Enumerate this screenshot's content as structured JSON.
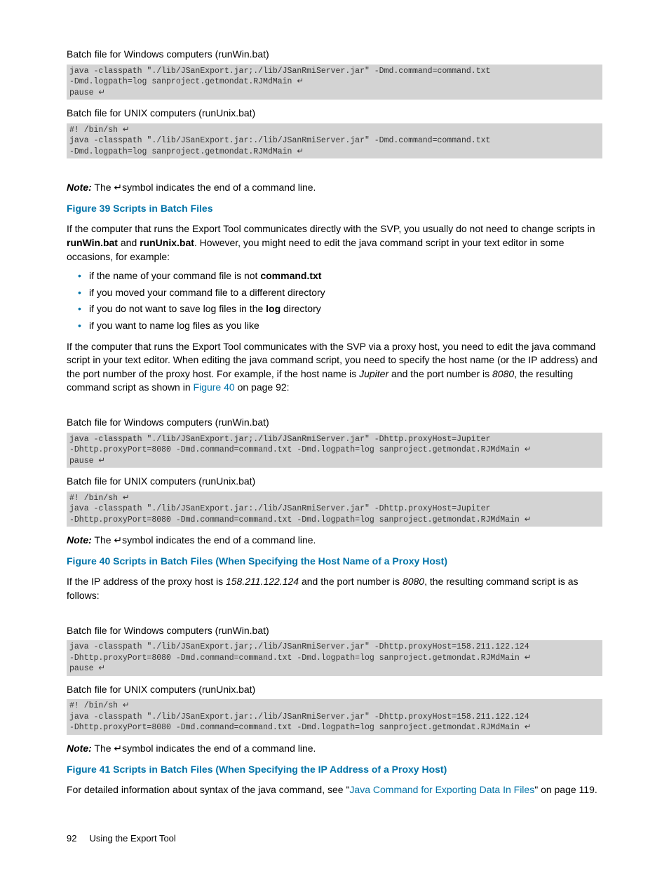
{
  "sec1": {
    "winCaption": "Batch file for Windows computers (runWin.bat)",
    "winCode": "java -classpath \"./lib/JSanExport.jar;./lib/JSanRmiServer.jar\" -Dmd.command=command.txt\n-Dmd.logpath=log sanproject.getmondat.RJMdMain ↵\npause ↵",
    "unixCaption": "Batch file for UNIX computers (runUnix.bat)",
    "unixCode": "#! /bin/sh ↵\njava -classpath \"./lib/JSanExport.jar:./lib/JSanRmiServer.jar\" -Dmd.command=command.txt\n-Dmd.logpath=log sanproject.getmondat.RJMdMain ↵"
  },
  "noteLabel": "Note:",
  "noteText": " The ↵symbol indicates the end of a command line.",
  "fig39": "Figure 39 Scripts in Batch Files",
  "para1_a": "If the computer that runs the Export Tool communicates directly with the SVP, you usually do not need to change scripts in ",
  "para1_b": "runWin.bat",
  "para1_c": " and ",
  "para1_d": "runUnix.bat",
  "para1_e": ". However, you might need to edit the java command script in your text editor in some occasions, for example:",
  "bullets": {
    "b1a": "if the name of your command file is not ",
    "b1b": "command.txt",
    "b2": "if you moved your command file to a different directory",
    "b3a": "if you do not want to save log files in the ",
    "b3b": "log",
    "b3c": " directory",
    "b4": "if you want to name log files as you like"
  },
  "para2_a": "If the computer that runs the Export Tool communicates with the SVP via a proxy host, you need to edit the java command script in your text editor. When editing the java command script, you need to specify the host name (or the IP address) and the port number of the proxy host. For example, if the host name is ",
  "para2_b": "Jupiter",
  "para2_c": " and the port number is ",
  "para2_d": "8080",
  "para2_e": ", the resulting command script as shown in ",
  "para2_link": "Figure 40",
  "para2_f": " on page 92:",
  "sec2": {
    "winCaption": "Batch file for Windows computers (runWin.bat)",
    "winCode": "java -classpath \"./lib/JSanExport.jar;./lib/JSanRmiServer.jar\" -Dhttp.proxyHost=Jupiter\n-Dhttp.proxyPort=8080 -Dmd.command=command.txt -Dmd.logpath=log sanproject.getmondat.RJMdMain ↵\npause ↵",
    "unixCaption": "Batch file for UNIX computers (runUnix.bat)",
    "unixCode": "#! /bin/sh ↵\njava -classpath \"./lib/JSanExport.jar:./lib/JSanRmiServer.jar\" -Dhttp.proxyHost=Jupiter\n-Dhttp.proxyPort=8080 -Dmd.command=command.txt -Dmd.logpath=log sanproject.getmondat.RJMdMain ↵"
  },
  "fig40": "Figure 40 Scripts in Batch Files (When Specifying the Host Name of a Proxy Host)",
  "para3_a": "If the IP address of the proxy host is ",
  "para3_b": "158.211.122.124",
  "para3_c": " and the port number is ",
  "para3_d": "8080",
  "para3_e": ", the resulting command script is as follows:",
  "sec3": {
    "winCaption": "Batch file for Windows computers (runWin.bat)",
    "winCode": "java -classpath \"./lib/JSanExport.jar;./lib/JSanRmiServer.jar\" -Dhttp.proxyHost=158.211.122.124\n-Dhttp.proxyPort=8080 -Dmd.command=command.txt -Dmd.logpath=log sanproject.getmondat.RJMdMain ↵\npause ↵",
    "unixCaption": "Batch file for UNIX computers (runUnix.bat)",
    "unixCode": "#! /bin/sh ↵\njava -classpath \"./lib/JSanExport.jar:./lib/JSanRmiServer.jar\" -Dhttp.proxyHost=158.211.122.124\n-Dhttp.proxyPort=8080 -Dmd.command=command.txt -Dmd.logpath=log sanproject.getmondat.RJMdMain ↵"
  },
  "fig41": "Figure 41 Scripts in Batch Files (When Specifying the IP Address of a Proxy Host)",
  "para4_a": "For detailed information about syntax of the java command, see \"",
  "para4_link": "Java Command for Exporting Data In Files",
  "para4_b": "\" on page 119.",
  "footer": {
    "page": "92",
    "title": "Using the Export Tool"
  }
}
